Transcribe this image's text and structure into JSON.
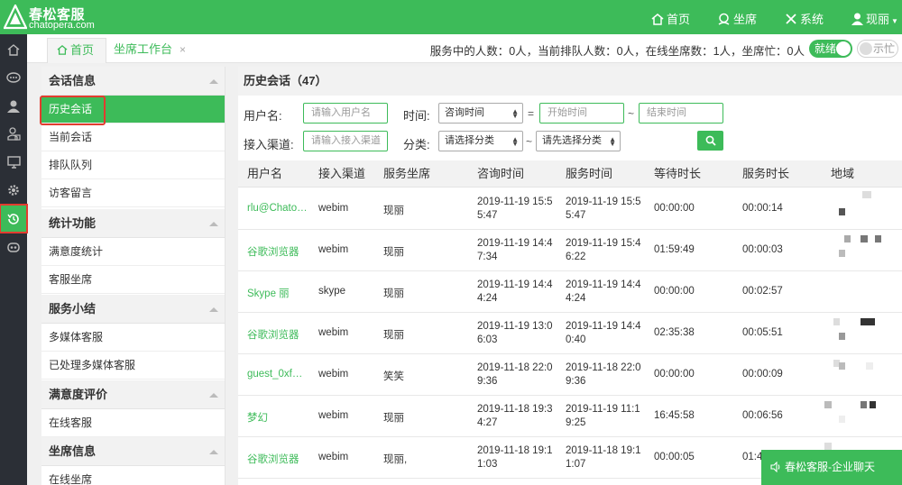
{
  "brand": {
    "name": "春松客服",
    "subtitle": "chatopera.com"
  },
  "topnav": {
    "home": "首页",
    "agent": "坐席",
    "system": "系统",
    "user": "现丽"
  },
  "tabs": {
    "home": "首页",
    "workbench": "坐席工作台",
    "close": "×"
  },
  "status": {
    "text": "服务中的人数：0人，当前排队人数：0人，在线坐席数：1人，坐席忙：0人",
    "ready_label": "就绪",
    "busy_label": "示忙"
  },
  "sidebar_icons": [
    "home-icon",
    "chat-bubble-icon",
    "user-icon",
    "user-group-icon",
    "monitor-icon",
    "gear-icon",
    "history-icon",
    "robot-icon"
  ],
  "menu": {
    "sections": [
      {
        "title": "会话信息",
        "items": [
          "历史会话",
          "当前会话",
          "排队队列",
          "访客留言"
        ]
      },
      {
        "title": "统计功能",
        "items": [
          "满意度统计",
          "客服坐席"
        ]
      },
      {
        "title": "服务小结",
        "items": [
          "多媒体客服",
          "已处理多媒体客服"
        ]
      },
      {
        "title": "满意度评价",
        "items": [
          "在线客服"
        ]
      },
      {
        "title": "坐席信息",
        "items": [
          "在线坐席"
        ]
      }
    ],
    "active_item": "历史会话"
  },
  "panel": {
    "title": "历史会话（47）"
  },
  "filters": {
    "username_label": "用户名:",
    "username_placeholder": "请输入用户名",
    "time_label": "时间:",
    "time_select": "咨询时间",
    "eq": "=",
    "start_placeholder": "开始时间",
    "tilde": "~",
    "end_placeholder": "结束时间",
    "channel_label": "接入渠道:",
    "channel_placeholder": "请输入接入渠道",
    "category_label": "分类:",
    "category_select": "请选择分类",
    "subcategory_select": "请先选择分类"
  },
  "table": {
    "headers": [
      "用户名",
      "接入渠道",
      "服务坐席",
      "咨询时间",
      "服务时间",
      "等待时长",
      "服务时长",
      "地域"
    ],
    "rows": [
      {
        "user": "rlu@Chato…",
        "channel": "webim",
        "agent": "现丽",
        "consult_1": "2019-11-19 15:5",
        "consult_2": "5:47",
        "service_1": "2019-11-19 15:5",
        "service_2": "5:47",
        "wait": "00:00:00",
        "duration": "00:00:14"
      },
      {
        "user": "谷歌浏览器",
        "channel": "webim",
        "agent": "现丽",
        "consult_1": "2019-11-19 14:4",
        "consult_2": "7:34",
        "service_1": "2019-11-19 15:4",
        "service_2": "6:22",
        "wait": "01:59:49",
        "duration": "00:00:03"
      },
      {
        "user": "Skype 丽",
        "channel": "skype",
        "agent": "现丽",
        "consult_1": "2019-11-19 14:4",
        "consult_2": "4:24",
        "service_1": "2019-11-19 14:4",
        "service_2": "4:24",
        "wait": "00:00:00",
        "duration": "00:02:57"
      },
      {
        "user": "谷歌浏览器",
        "channel": "webim",
        "agent": "现丽",
        "consult_1": "2019-11-19 13:0",
        "consult_2": "6:03",
        "service_1": "2019-11-19 14:4",
        "service_2": "0:40",
        "wait": "02:35:38",
        "duration": "00:05:51"
      },
      {
        "user": "guest_0xf…",
        "channel": "webim",
        "agent": "笑笑",
        "consult_1": "2019-11-18 22:0",
        "consult_2": "9:36",
        "service_1": "2019-11-18 22:0",
        "service_2": "9:36",
        "wait": "00:00:00",
        "duration": "00:00:09"
      },
      {
        "user": "梦幻",
        "channel": "webim",
        "agent": "现丽",
        "consult_1": "2019-11-18 19:3",
        "consult_2": "4:27",
        "service_1": "2019-11-19 11:1",
        "service_2": "9:25",
        "wait": "16:45:58",
        "duration": "00:06:56"
      },
      {
        "user": "谷歌浏览器",
        "channel": "webim",
        "agent": "现丽,",
        "consult_1": "2019-11-18 19:1",
        "consult_2": "1:03",
        "service_1": "2019-11-18 19:1",
        "service_2": "1:07",
        "wait": "00:00:05",
        "duration": "01:4"
      }
    ]
  },
  "chat_button": {
    "label": "春松客服-企业聊天"
  },
  "colors": {
    "brand_green": "#3dbb59",
    "sidebar_dark": "#2b2f36",
    "highlight_red": "#e23c2f"
  }
}
